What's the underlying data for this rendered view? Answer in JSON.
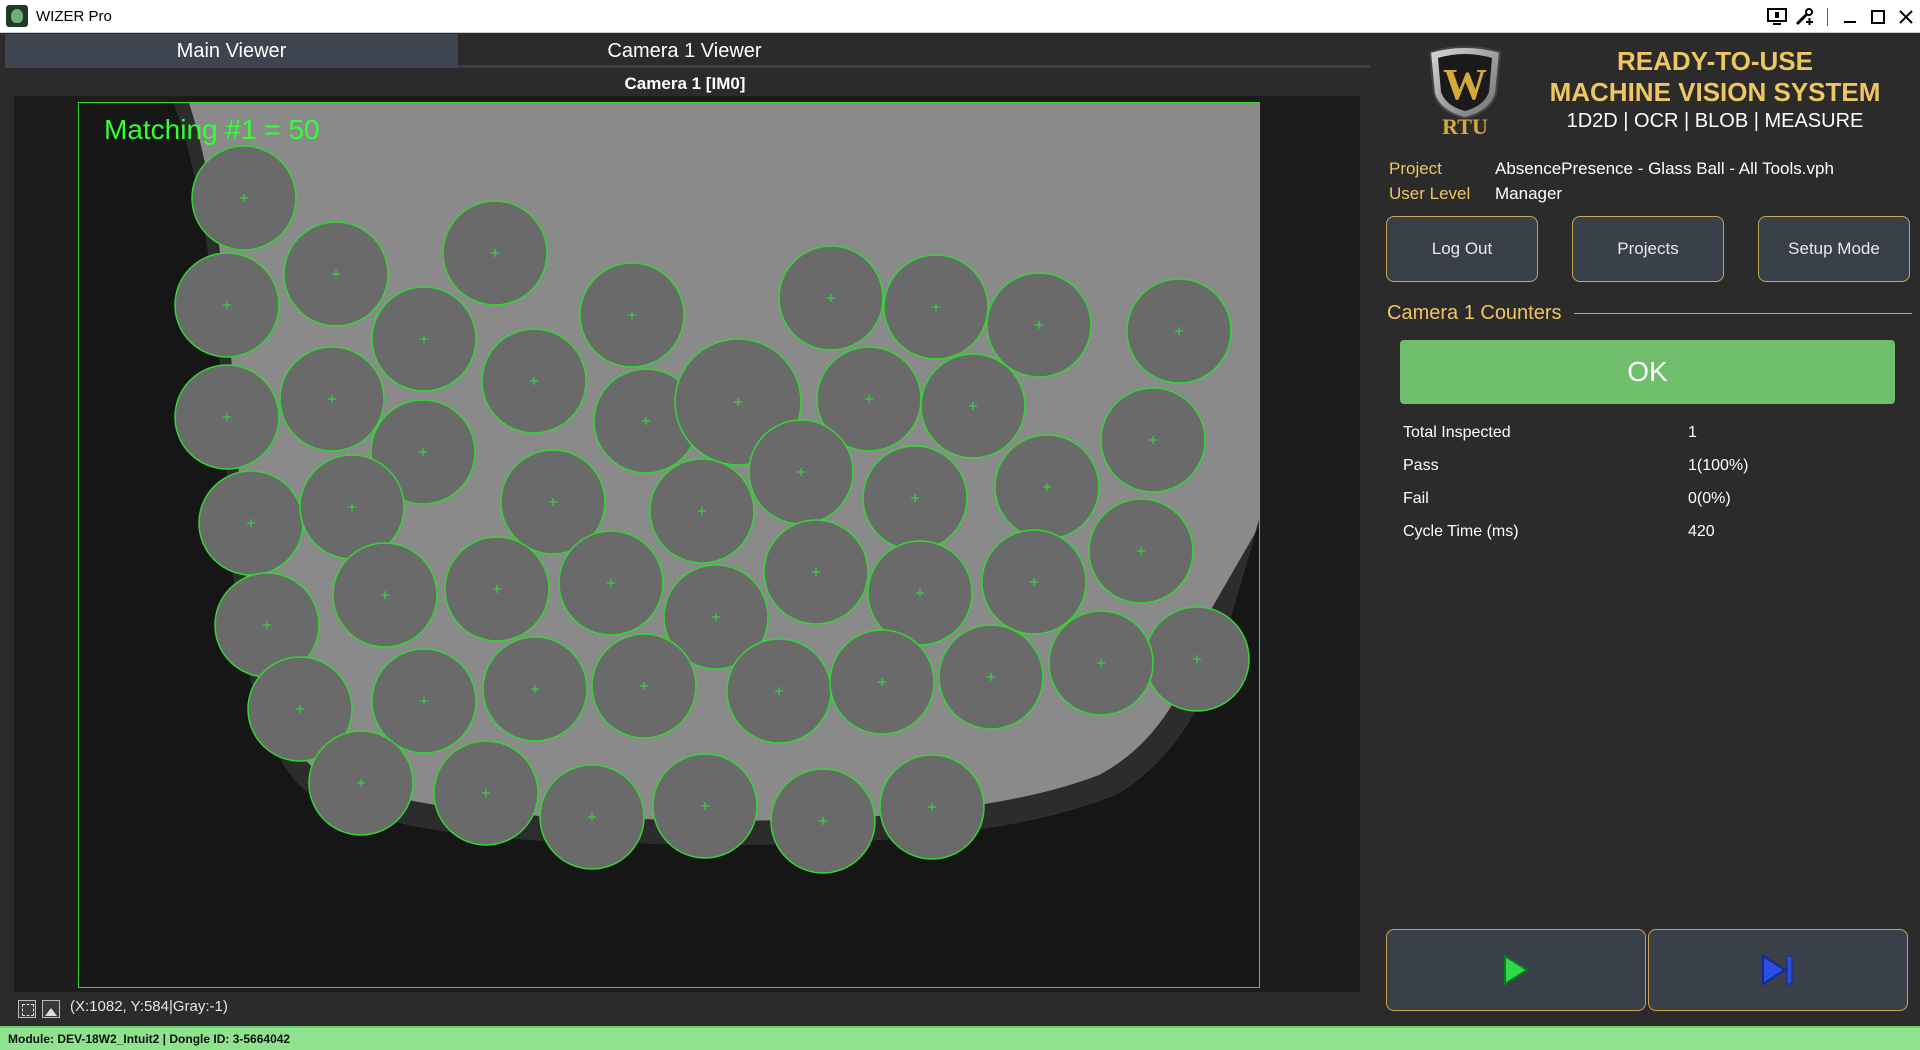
{
  "window": {
    "title": "WIZER Pro",
    "controls": [
      "monitor-icon",
      "tools-icon",
      "minimize-icon",
      "maximize-icon",
      "close-icon"
    ]
  },
  "tabs": [
    {
      "label": "Main Viewer",
      "active": true
    },
    {
      "label": "Camera 1 Viewer",
      "active": false
    }
  ],
  "viewer": {
    "camera_title": "Camera 1  [IM0]",
    "matching_label": "Matching #1 = 50",
    "coords": "(X:1082, Y:584|Gray:-1)",
    "overlay_color": "#33d633"
  },
  "brand": {
    "logo_text": "RTU",
    "logo_letter": "W",
    "headline_1": "READY-TO-USE",
    "headline_2": "MACHINE VISION SYSTEM",
    "subline": "1D2D | OCR | BLOB | MEASURE",
    "accent": "#f0c65e"
  },
  "info": {
    "project_label": "Project",
    "project_value": "AbsencePresence - Glass Ball - All Tools.vph",
    "level_label": "User Level",
    "level_value": "Manager"
  },
  "buttons": {
    "logout": "Log Out",
    "projects": "Projects",
    "setup": "Setup Mode"
  },
  "counters": {
    "title": "Camera 1 Counters",
    "status": "OK",
    "status_color": "#6fbe6b",
    "rows": [
      {
        "label": "Total Inspected",
        "value": "1"
      },
      {
        "label": "Pass",
        "value": "1(100%)"
      },
      {
        "label": "Fail",
        "value": "0(0%)"
      },
      {
        "label": "Cycle Time (ms)",
        "value": "420"
      }
    ]
  },
  "run_controls": [
    "play-icon",
    "step-icon"
  ],
  "status_bar": {
    "text": "Module: DEV-18W2_Intuit2 | Dongle ID: 3-5664042",
    "color": "#8fe38f"
  }
}
